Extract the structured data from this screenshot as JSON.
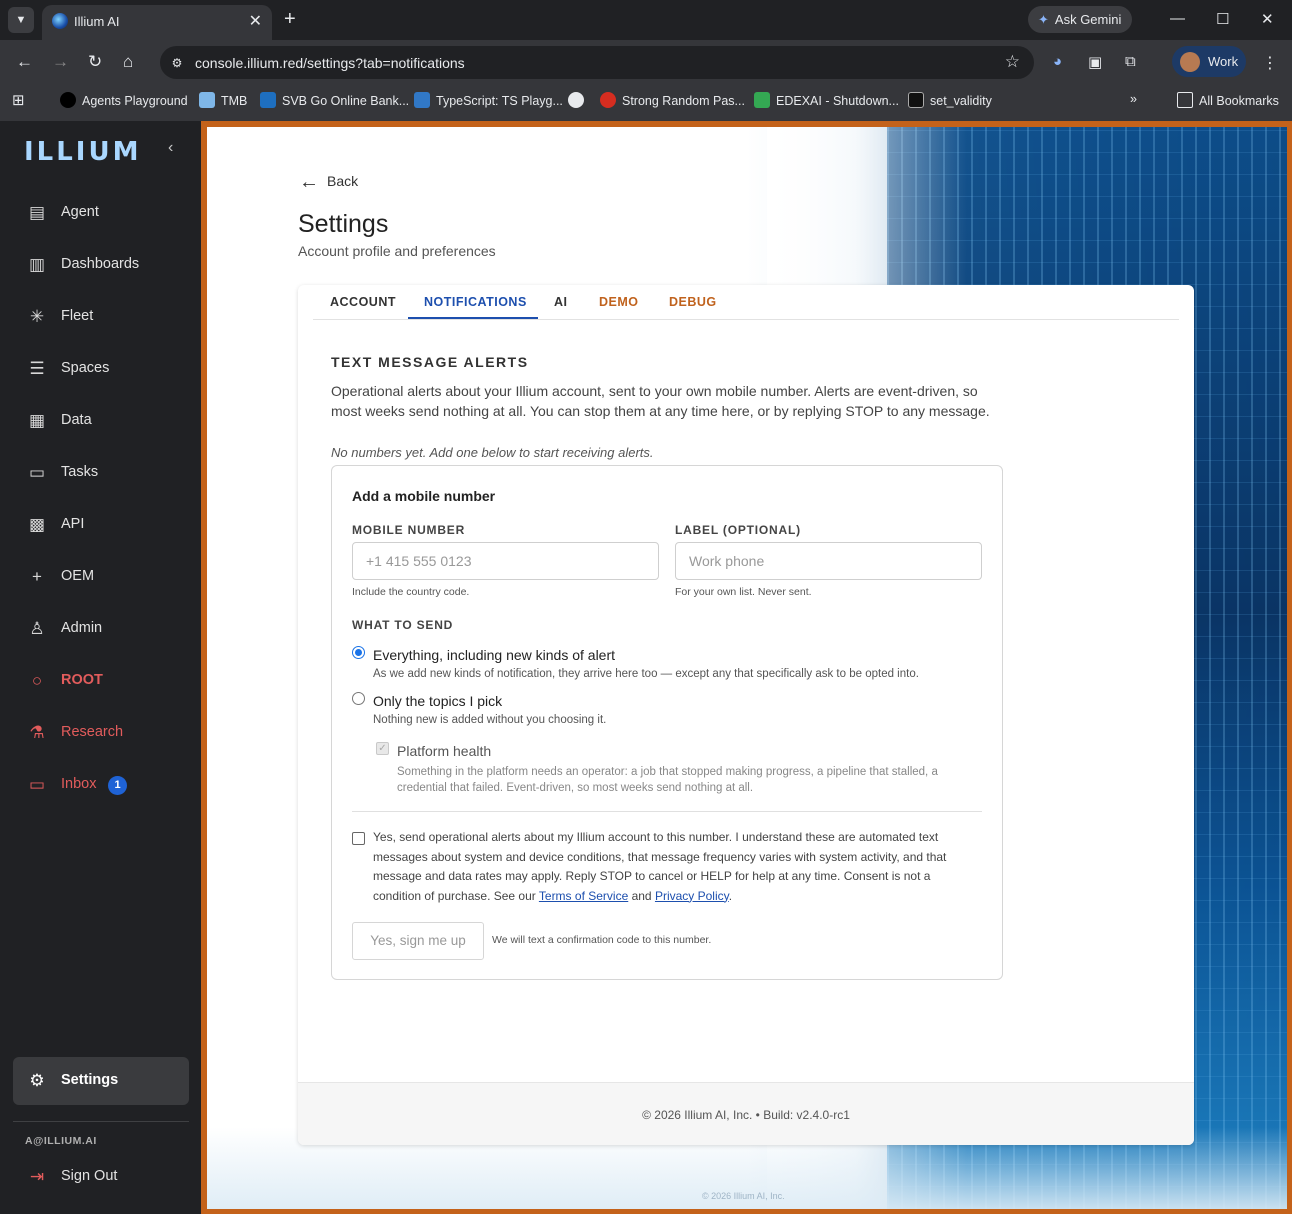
{
  "browser": {
    "tab_title": "Illium AI",
    "ask_gemini": "Ask Gemini",
    "url": "console.illium.red/settings?tab=notifications",
    "profile": "Work",
    "bookmarks": [
      "Agents Playground",
      "TMB",
      "SVB Go Online Bank...",
      "TypeScript: TS Playg...",
      "Strong Random Pas...",
      "EDEXAI - Shutdown...",
      "set_validity"
    ],
    "all_bookmarks": "All Bookmarks"
  },
  "sidebar": {
    "logo": "ILLIUM",
    "items": [
      {
        "label": "Agent",
        "icon": "chat-icon"
      },
      {
        "label": "Dashboards",
        "icon": "bar-chart-icon"
      },
      {
        "label": "Fleet",
        "icon": "network-icon"
      },
      {
        "label": "Spaces",
        "icon": "list-icon"
      },
      {
        "label": "Data",
        "icon": "data-chart-icon"
      },
      {
        "label": "Tasks",
        "icon": "tasks-icon"
      },
      {
        "label": "API",
        "icon": "api-icon"
      },
      {
        "label": "OEM",
        "icon": "plus-icon"
      },
      {
        "label": "Admin",
        "icon": "person-icon"
      },
      {
        "label": "ROOT",
        "icon": "circle-icon"
      },
      {
        "label": "Research",
        "icon": "flask-icon"
      },
      {
        "label": "Inbox",
        "icon": "inbox-icon",
        "badge": "1"
      }
    ],
    "settings": "Settings",
    "user_email": "A@ILLIUM.AI",
    "sign_out": "Sign Out"
  },
  "page": {
    "back": "Back",
    "title": "Settings",
    "subtitle": "Account profile and preferences",
    "tabs": [
      "ACCOUNT",
      "NOTIFICATIONS",
      "AI",
      "DEMO",
      "DEBUG"
    ],
    "active_tab": "NOTIFICATIONS"
  },
  "sms": {
    "section_title": "TEXT MESSAGE ALERTS",
    "description": "Operational alerts about your Illium account, sent to your own mobile number. Alerts are event-driven, so most weeks send nothing at all. You can stop them at any time here, or by replying STOP to any message.",
    "empty_note": "No numbers yet. Add one below to start receiving alerts.",
    "form_title": "Add a mobile number",
    "mobile_label": "MOBILE NUMBER",
    "mobile_placeholder": "+1 415 555 0123",
    "mobile_value": "",
    "mobile_helper": "Include the country code.",
    "label_label": "LABEL (OPTIONAL)",
    "label_placeholder": "Work phone",
    "label_value": "",
    "label_helper": "For your own list. Never sent.",
    "what_to_send": "WHAT TO SEND",
    "option_everything": "Everything, including new kinds of alert",
    "option_everything_desc": "As we add new kinds of notification, they arrive here too — except any that specifically ask to be opted into.",
    "option_topics": "Only the topics I pick",
    "option_topics_desc": "Nothing new is added without you choosing it.",
    "selected_option": "everything",
    "topic_platform_health": "Platform health",
    "topic_platform_health_desc": "Something in the platform needs an operator: a job that stopped making progress, a pipeline that stalled, a credential that failed. Event-driven, so most weeks send nothing at all.",
    "consent_prefix": "Yes, send operational alerts about my Illium account to this number. I understand these are automated text messages about system and device conditions, that message frequency varies with system activity, and that message and data rates may apply. Reply STOP to cancel or HELP for help at any time. Consent is not a condition of purchase. See our ",
    "terms_link": "Terms of Service",
    "consent_and": " and ",
    "privacy_link": "Privacy Policy",
    "consent_suffix": ".",
    "consent_checked": false,
    "signup_button": "Yes, sign me up",
    "signup_note": "We will text a confirmation code to this number."
  },
  "footer": {
    "text": "© 2026 Illium AI, Inc. • Build: v2.4.0-rc1",
    "bg_text": "© 2026 Illium AI, Inc."
  },
  "colors": {
    "accent": "#1d4fae",
    "orange_tab": "#c0621d",
    "sidebar_red": "#e25c5c",
    "frame_border": "#c4621a"
  }
}
